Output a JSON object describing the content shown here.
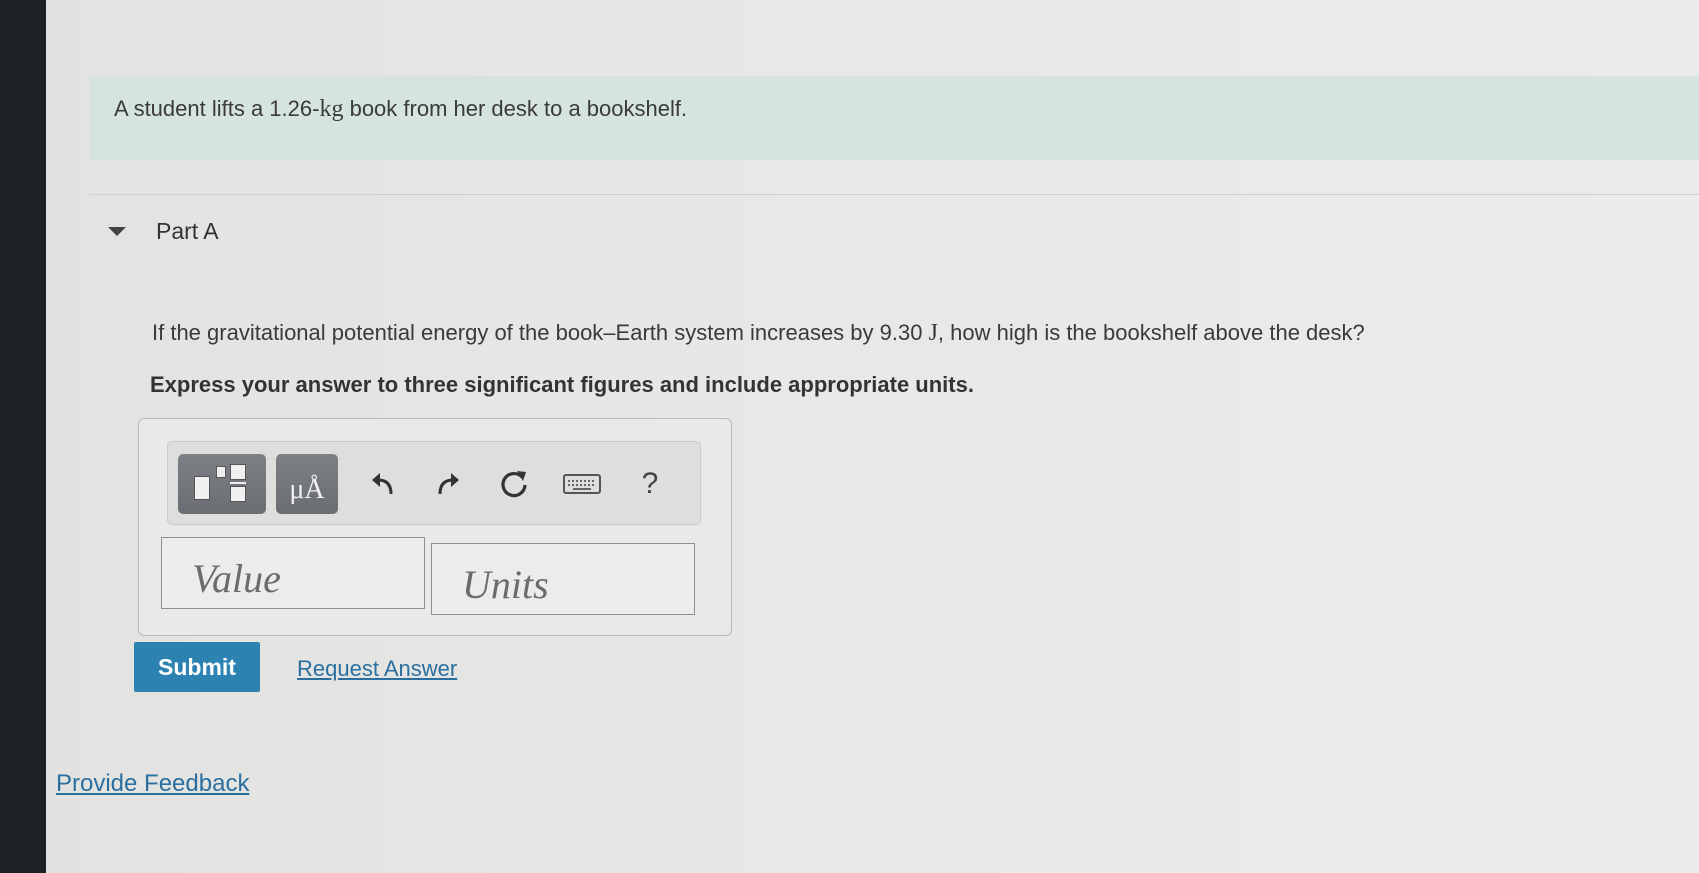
{
  "intro": {
    "prefix": "A student lifts a 1.26-",
    "mass_unit": "kg",
    "suffix": " book from her desk to a bookshelf."
  },
  "part": {
    "title": "Part A",
    "question_prefix": "If the gravitational potential energy of the book–Earth system increases by 9.30 ",
    "energy_unit": "J",
    "question_suffix": ", how high is the bookshelf above the desk?",
    "instruction": "Express your answer to three significant figures and include appropriate units."
  },
  "toolbar": {
    "units_label": "μÅ",
    "help_label": "?",
    "icons": [
      "templates-icon",
      "units-icon",
      "undo-icon",
      "redo-icon",
      "reset-icon",
      "keyboard-icon",
      "help-icon"
    ]
  },
  "inputs": {
    "value_placeholder": "Value",
    "units_placeholder": "Units"
  },
  "actions": {
    "submit_label": "Submit",
    "request_answer_label": "Request Answer",
    "feedback_label": "Provide Feedback"
  },
  "colors": {
    "intro_background": "#d6e4e0",
    "submit_background": "#2c83b2",
    "link": "#2a6fa0",
    "toolbar_button": "#6f7277"
  }
}
